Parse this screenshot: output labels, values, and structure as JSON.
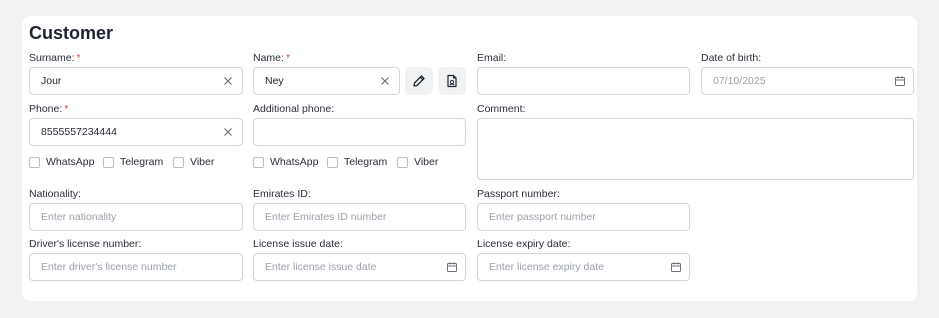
{
  "section": {
    "title": "Customer"
  },
  "fields": {
    "surname": {
      "label": "Surname:",
      "required": "*",
      "value": "Jour"
    },
    "name": {
      "label": "Name:",
      "required": "*",
      "value": "Ney"
    },
    "email": {
      "label": "Email:",
      "value": ""
    },
    "dob": {
      "label": "Date of birth:",
      "placeholder": "07/10/2025"
    },
    "phone": {
      "label": "Phone:",
      "required": "*",
      "value": "8555557234444"
    },
    "additional_phone": {
      "label": "Additional phone:",
      "value": ""
    },
    "comment": {
      "label": "Comment:",
      "value": ""
    },
    "nationality": {
      "label": "Nationality:",
      "placeholder": "Enter nationality"
    },
    "emirates_id": {
      "label": "Emirates ID:",
      "placeholder": "Enter Emirates ID number"
    },
    "passport": {
      "label": "Passport number:",
      "placeholder": "Enter passport number"
    },
    "license_number": {
      "label": "Driver's license number:",
      "placeholder": "Enter driver's license number"
    },
    "license_issue": {
      "label": "License issue date:",
      "placeholder": "Enter license issue date"
    },
    "license_expiry": {
      "label": "License expiry date:",
      "placeholder": "Enter license expiry date"
    }
  },
  "messengers": {
    "phone": [
      "WhatsApp",
      "Telegram",
      "Viber"
    ],
    "additional_phone": [
      "WhatsApp",
      "Telegram",
      "Viber"
    ]
  },
  "icons": {
    "clear": "close-icon",
    "edit": "pencil-icon",
    "document": "document-icon",
    "calendar": "calendar-icon"
  },
  "colors": {
    "required": "#e0463c",
    "border": "#d3d6dc",
    "placeholder": "#9ba1ab",
    "background": "#f2f2f3"
  }
}
